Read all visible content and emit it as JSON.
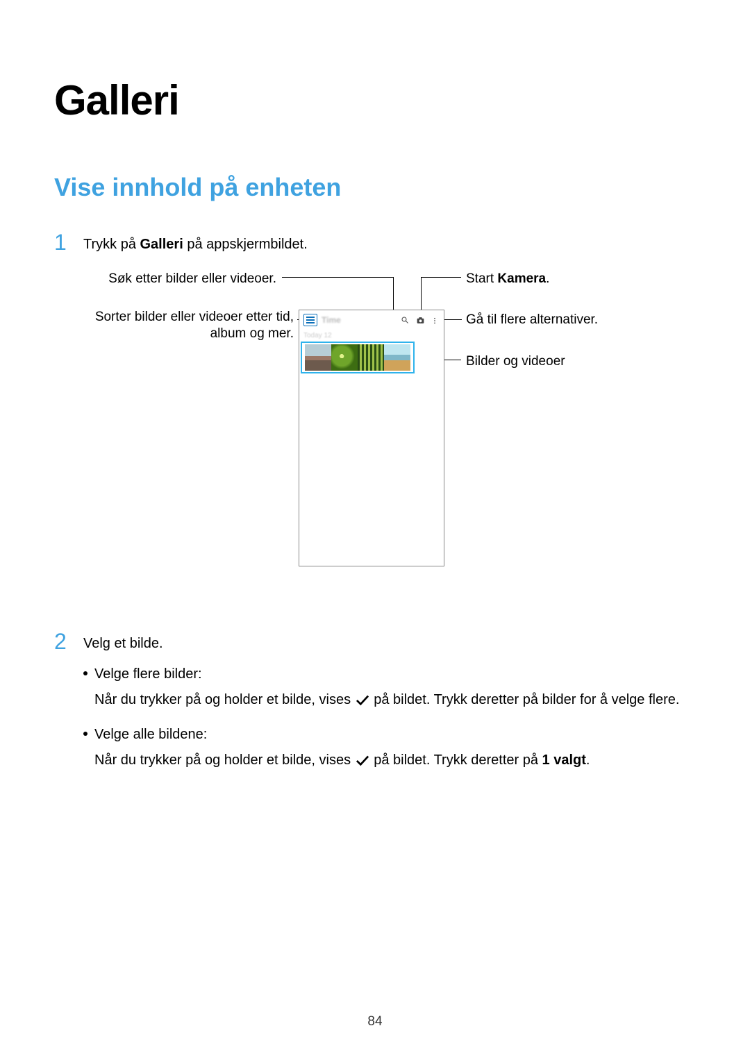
{
  "page_number": "84",
  "h1": "Galleri",
  "h2": "Vise innhold på enheten",
  "step1": {
    "num": "1",
    "text_pre": "Trykk på ",
    "bold": "Galleri",
    "text_post": " på appskjermbildet."
  },
  "callouts": {
    "search": "Søk etter bilder eller videoer.",
    "sort_line1": "Sorter bilder eller videoer etter tid,",
    "sort_line2": "album og mer.",
    "start_camera_pre": "Start ",
    "start_camera_bold": "Kamera",
    "start_camera_post": ".",
    "more_options": "Gå til flere alternativer.",
    "media": "Bilder og videoer"
  },
  "phone": {
    "time": "Time",
    "date": "Today  12"
  },
  "step2": {
    "num": "2",
    "text": "Velg et bilde.",
    "bullet1_title": "Velge flere bilder:",
    "bullet1_body_pre": "Når du trykker på og holder et bilde, vises ",
    "bullet1_body_post": " på bildet. Trykk deretter på bilder for å velge flere.",
    "bullet2_title": "Velge alle bildene:",
    "bullet2_body_pre": "Når du trykker på og holder et bilde, vises ",
    "bullet2_body_mid": " på bildet. Trykk deretter på ",
    "bullet2_body_bold": "1 valgt",
    "bullet2_body_post": "."
  }
}
